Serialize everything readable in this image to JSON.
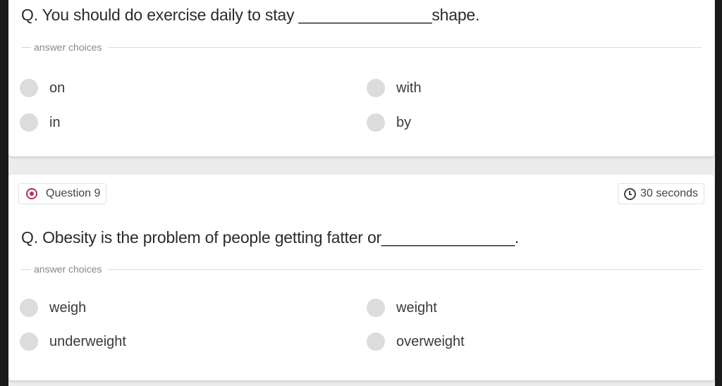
{
  "question_8": {
    "text": "Q. You should do exercise daily to stay _______________shape.",
    "answer_choices_label": "answer choices",
    "options": [
      {
        "label": "on"
      },
      {
        "label": "with"
      },
      {
        "label": "in"
      },
      {
        "label": "by"
      }
    ]
  },
  "question_9": {
    "number_label": "Question 9",
    "time_label": "30 seconds",
    "text": "Q. Obesity is the problem of people getting fatter or_______________.",
    "answer_choices_label": "answer choices",
    "options": [
      {
        "label": "weigh"
      },
      {
        "label": "weight"
      },
      {
        "label": "underweight"
      },
      {
        "label": "overweight"
      }
    ]
  },
  "colors": {
    "accent": "#b0335e",
    "radio": "#dcdcdc",
    "page_background": "#ececec",
    "card_background": "#ffffff"
  },
  "icons": [
    "target-icon",
    "clock-icon"
  ]
}
